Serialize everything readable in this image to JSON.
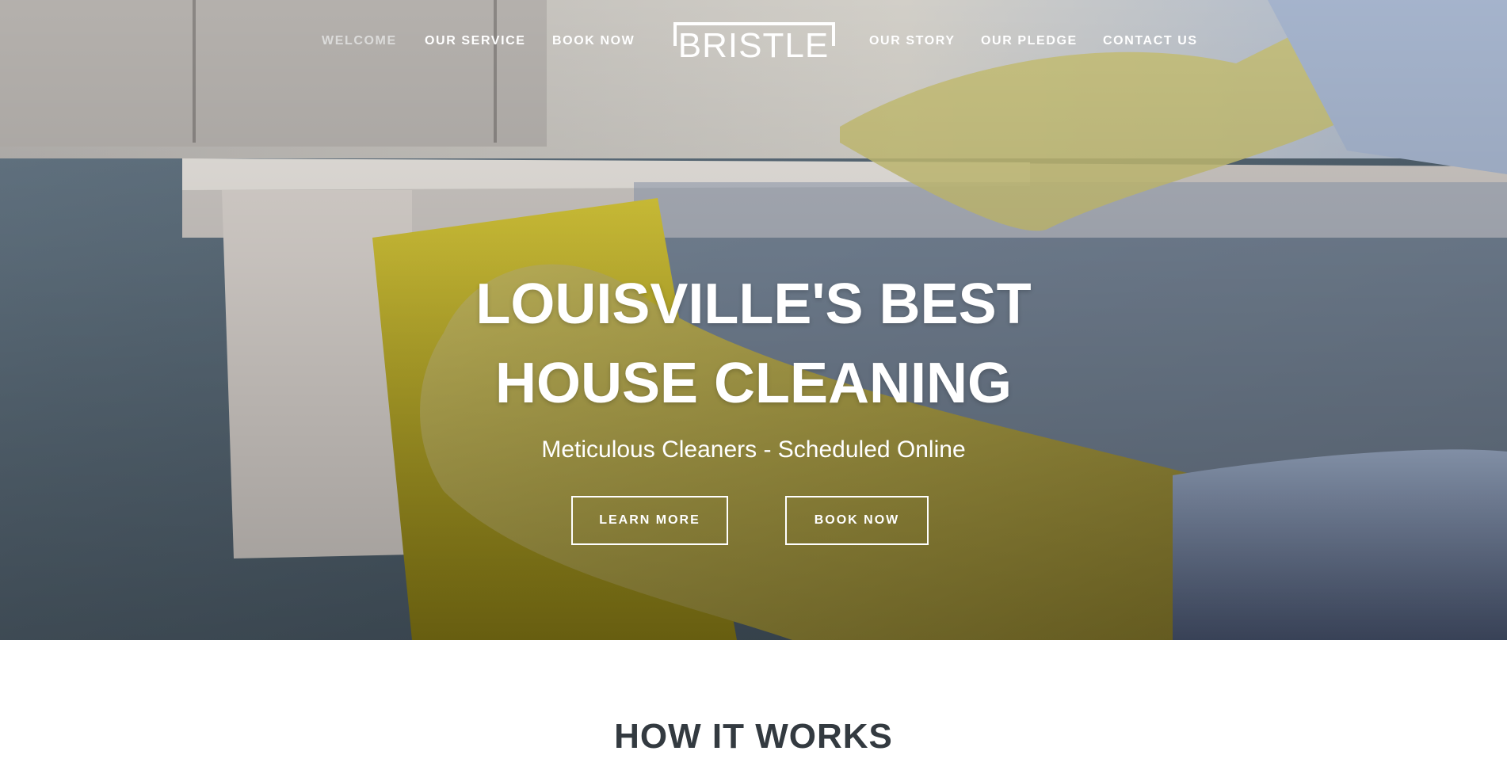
{
  "brand": {
    "name": "BRISTLE"
  },
  "nav": {
    "left": [
      {
        "label": "WELCOME",
        "active": true
      },
      {
        "label": "OUR SERVICE"
      },
      {
        "label": "BOOK NOW"
      }
    ],
    "right": [
      {
        "label": "OUR STORY"
      },
      {
        "label": "OUR PLEDGE"
      },
      {
        "label": "CONTACT US"
      }
    ]
  },
  "hero": {
    "title_line1": "LOUISVILLE'S BEST",
    "title_line2": "HOUSE CLEANING",
    "subtitle": "Meticulous Cleaners - Scheduled Online",
    "learn_more_label": "LEARN MORE",
    "book_now_label": "BOOK NOW",
    "image": "gloved hand cleaning window trim with a yellow sponge"
  },
  "section": {
    "title": "HOW IT WORKS"
  },
  "colors": {
    "text_dark": "#333a40",
    "glove": "#c9bf5a",
    "sponge": "#c8ba2c",
    "wall": "#8a9aaa"
  }
}
